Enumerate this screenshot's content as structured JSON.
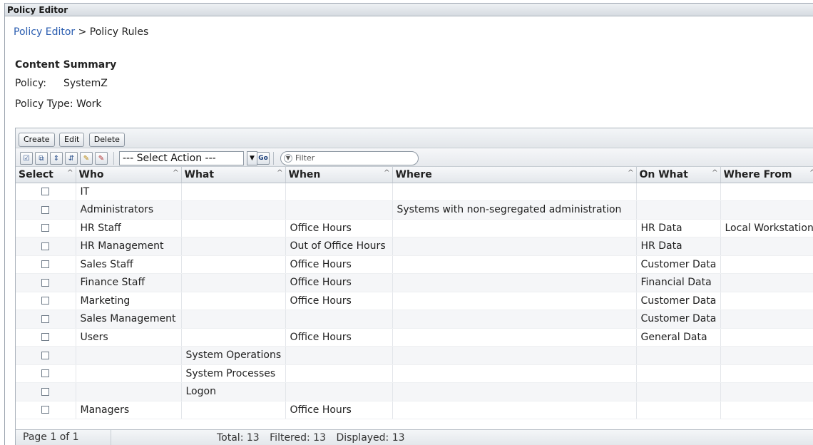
{
  "window": {
    "title": "Policy Editor"
  },
  "breadcrumb": {
    "link": "Policy Editor",
    "separator": ">",
    "current": "Policy Rules"
  },
  "summary": {
    "title": "Content Summary",
    "policy_label": "Policy:",
    "policy_value": "SystemZ",
    "type_label": "Policy Type:",
    "type_value": "Work"
  },
  "toolbar": {
    "create": "Create",
    "edit": "Edit",
    "delete": "Delete"
  },
  "actions": {
    "select_action": "--- Select Action ---",
    "go": "Go",
    "filter_placeholder": "Filter"
  },
  "columns": [
    "Select",
    "Who",
    "What",
    "When",
    "Where",
    "On What",
    "Where From"
  ],
  "rows": [
    {
      "who": "IT",
      "what": "",
      "when": "",
      "where": "",
      "on_what": "",
      "where_from": ""
    },
    {
      "who": "Administrators",
      "what": "",
      "when": "",
      "where": "Systems with non-segregated administration",
      "on_what": "",
      "where_from": ""
    },
    {
      "who": "HR Staff",
      "what": "",
      "when": "Office Hours",
      "where": "",
      "on_what": "HR Data",
      "where_from": "Local Workstation"
    },
    {
      "who": "HR Management",
      "what": "",
      "when": "Out of Office Hours",
      "where": "",
      "on_what": "HR Data",
      "where_from": ""
    },
    {
      "who": "Sales Staff",
      "what": "",
      "when": "Office Hours",
      "where": "",
      "on_what": "Customer Data",
      "where_from": ""
    },
    {
      "who": "Finance Staff",
      "what": "",
      "when": "Office Hours",
      "where": "",
      "on_what": "Financial Data",
      "where_from": ""
    },
    {
      "who": "Marketing",
      "what": "",
      "when": "Office Hours",
      "where": "",
      "on_what": "Customer Data",
      "where_from": ""
    },
    {
      "who": "Sales Management",
      "what": "",
      "when": "",
      "where": "",
      "on_what": "Customer Data",
      "where_from": ""
    },
    {
      "who": "Users",
      "what": "",
      "when": "Office Hours",
      "where": "",
      "on_what": "General Data",
      "where_from": ""
    },
    {
      "who": "",
      "what": "System Operations",
      "when": "",
      "where": "",
      "on_what": "",
      "where_from": ""
    },
    {
      "who": "",
      "what": "System Processes",
      "when": "",
      "where": "",
      "on_what": "",
      "where_from": ""
    },
    {
      "who": "",
      "what": "Logon",
      "when": "",
      "where": "",
      "on_what": "",
      "where_from": ""
    },
    {
      "who": "Managers",
      "what": "",
      "when": "Office Hours",
      "where": "",
      "on_what": "",
      "where_from": ""
    }
  ],
  "footer": {
    "page": "Page 1 of 1",
    "total": "Total: 13",
    "filtered": "Filtered: 13",
    "displayed": "Displayed: 13"
  }
}
